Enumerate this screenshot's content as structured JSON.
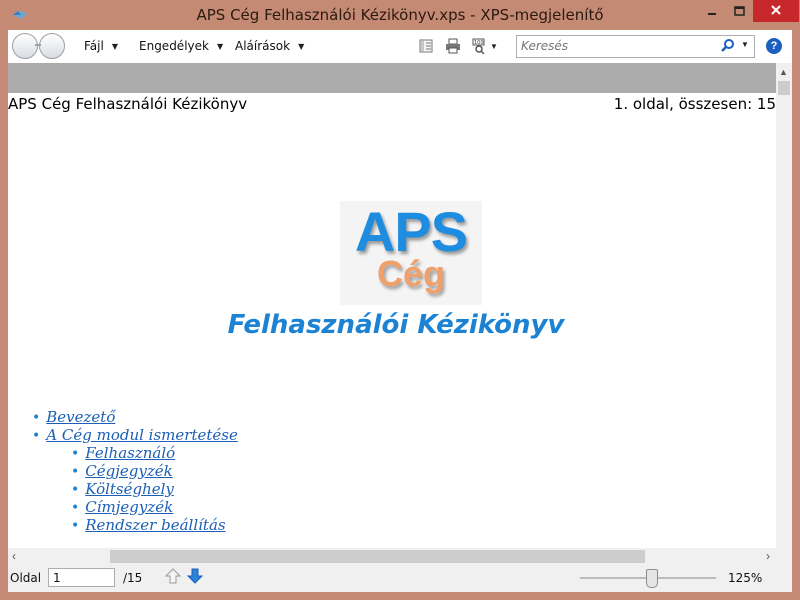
{
  "window": {
    "title": "APS Cég Felhasználói Kézikönyv.xps - XPS-megjelenítő"
  },
  "toolbar": {
    "menus": [
      {
        "label": "Fájl"
      },
      {
        "label": "Engedélyek"
      },
      {
        "label": "Aláírások"
      }
    ],
    "search": {
      "placeholder": "Keresés"
    }
  },
  "document": {
    "header_left": "APS Cég Felhasználói Kézikönyv",
    "header_right": "1. oldal, összesen: 15",
    "logo": {
      "line1": "APS",
      "line2": "Cég"
    },
    "title": "Felhasználói Kézikönyv",
    "toc": [
      {
        "label": "Bevezető",
        "level": 1
      },
      {
        "label": "A Cég modul ismertetése",
        "level": 1
      },
      {
        "label": "Felhasználó",
        "level": 2
      },
      {
        "label": "Cégjegyzék",
        "level": 2
      },
      {
        "label": "Költséghely",
        "level": 2
      },
      {
        "label": "Címjegyzék",
        "level": 2
      },
      {
        "label": "Rendszer beállítás",
        "level": 2
      }
    ]
  },
  "status": {
    "page_label": "Oldal",
    "page_value": "1",
    "page_total": "/15",
    "zoom": "125%",
    "zoom_slider_fraction": 0.53
  },
  "colors": {
    "link": "#1b5fb6",
    "title": "#1b82d4",
    "logo_blue": "#1e8de0",
    "logo_orange": "#f0a06a",
    "close_button": "#c7282b"
  }
}
